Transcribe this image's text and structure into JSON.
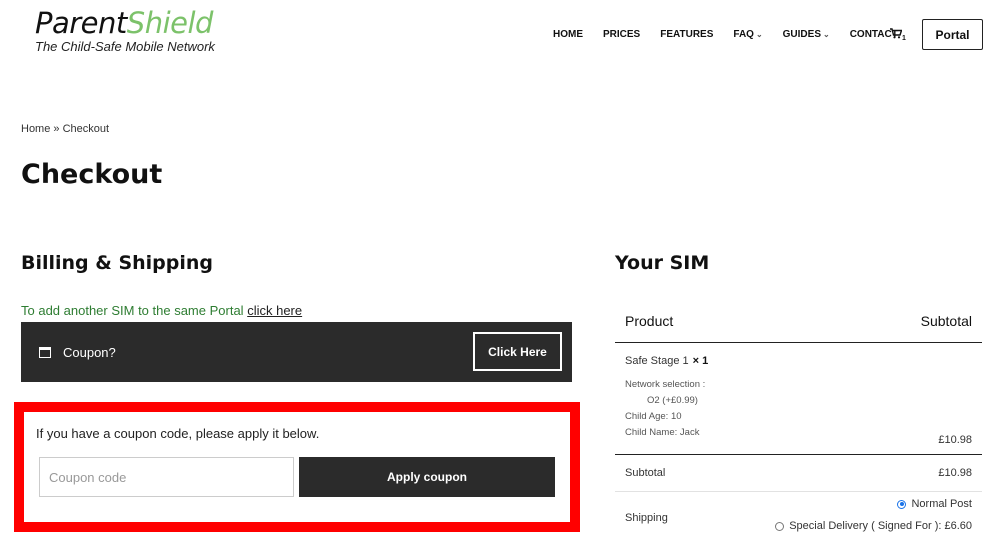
{
  "header": {
    "logo_part1": "Parent",
    "logo_part2": "Shield",
    "tagline": "The Child-Safe Mobile Network",
    "nav": [
      {
        "label": "HOME",
        "dropdown": false
      },
      {
        "label": "PRICES",
        "dropdown": false
      },
      {
        "label": "FEATURES",
        "dropdown": false
      },
      {
        "label": "FAQ",
        "dropdown": true
      },
      {
        "label": "GUIDES",
        "dropdown": true
      },
      {
        "label": "CONTACT",
        "dropdown": false
      }
    ],
    "cart_icon": "shopping-cart-icon",
    "cart_count": "1",
    "portal_label": "Portal"
  },
  "breadcrumb": {
    "home": "Home",
    "separator": "»",
    "current": "Checkout"
  },
  "page_title": "Checkout",
  "billing": {
    "title": "Billing & Shipping",
    "add_sim_text": "To add another SIM to the same Portal",
    "add_sim_link": "click here",
    "coupon_toggle": {
      "icon": "coupon-window-icon",
      "label": "Coupon?",
      "button": "Click Here"
    },
    "coupon_form": {
      "help_text": "If you have a coupon code, please apply it below.",
      "input_value": "",
      "input_placeholder": "Coupon code",
      "apply_label": "Apply coupon"
    }
  },
  "order": {
    "title": "Your SIM",
    "headers": {
      "product": "Product",
      "subtotal": "Subtotal"
    },
    "item": {
      "name": "Safe Stage 1",
      "qty": "× 1",
      "network_label": "Network selection :",
      "network_value": "O2 (+£0.99)",
      "child_age": "Child Age: 10",
      "child_name": "Child Name: Jack",
      "price": "£10.98"
    },
    "subtotal": {
      "label": "Subtotal",
      "value": "£10.98"
    },
    "shipping": {
      "label": "Shipping",
      "options": [
        {
          "label": "Normal Post",
          "selected": true
        },
        {
          "label": "Special Delivery ( Signed For ): £6.60",
          "selected": false
        }
      ]
    }
  },
  "colors": {
    "brand_green": "#7cc26a",
    "link_green": "#2e7d32",
    "dark_bar": "#2b2b2b",
    "highlight_red": "#ff0000"
  }
}
